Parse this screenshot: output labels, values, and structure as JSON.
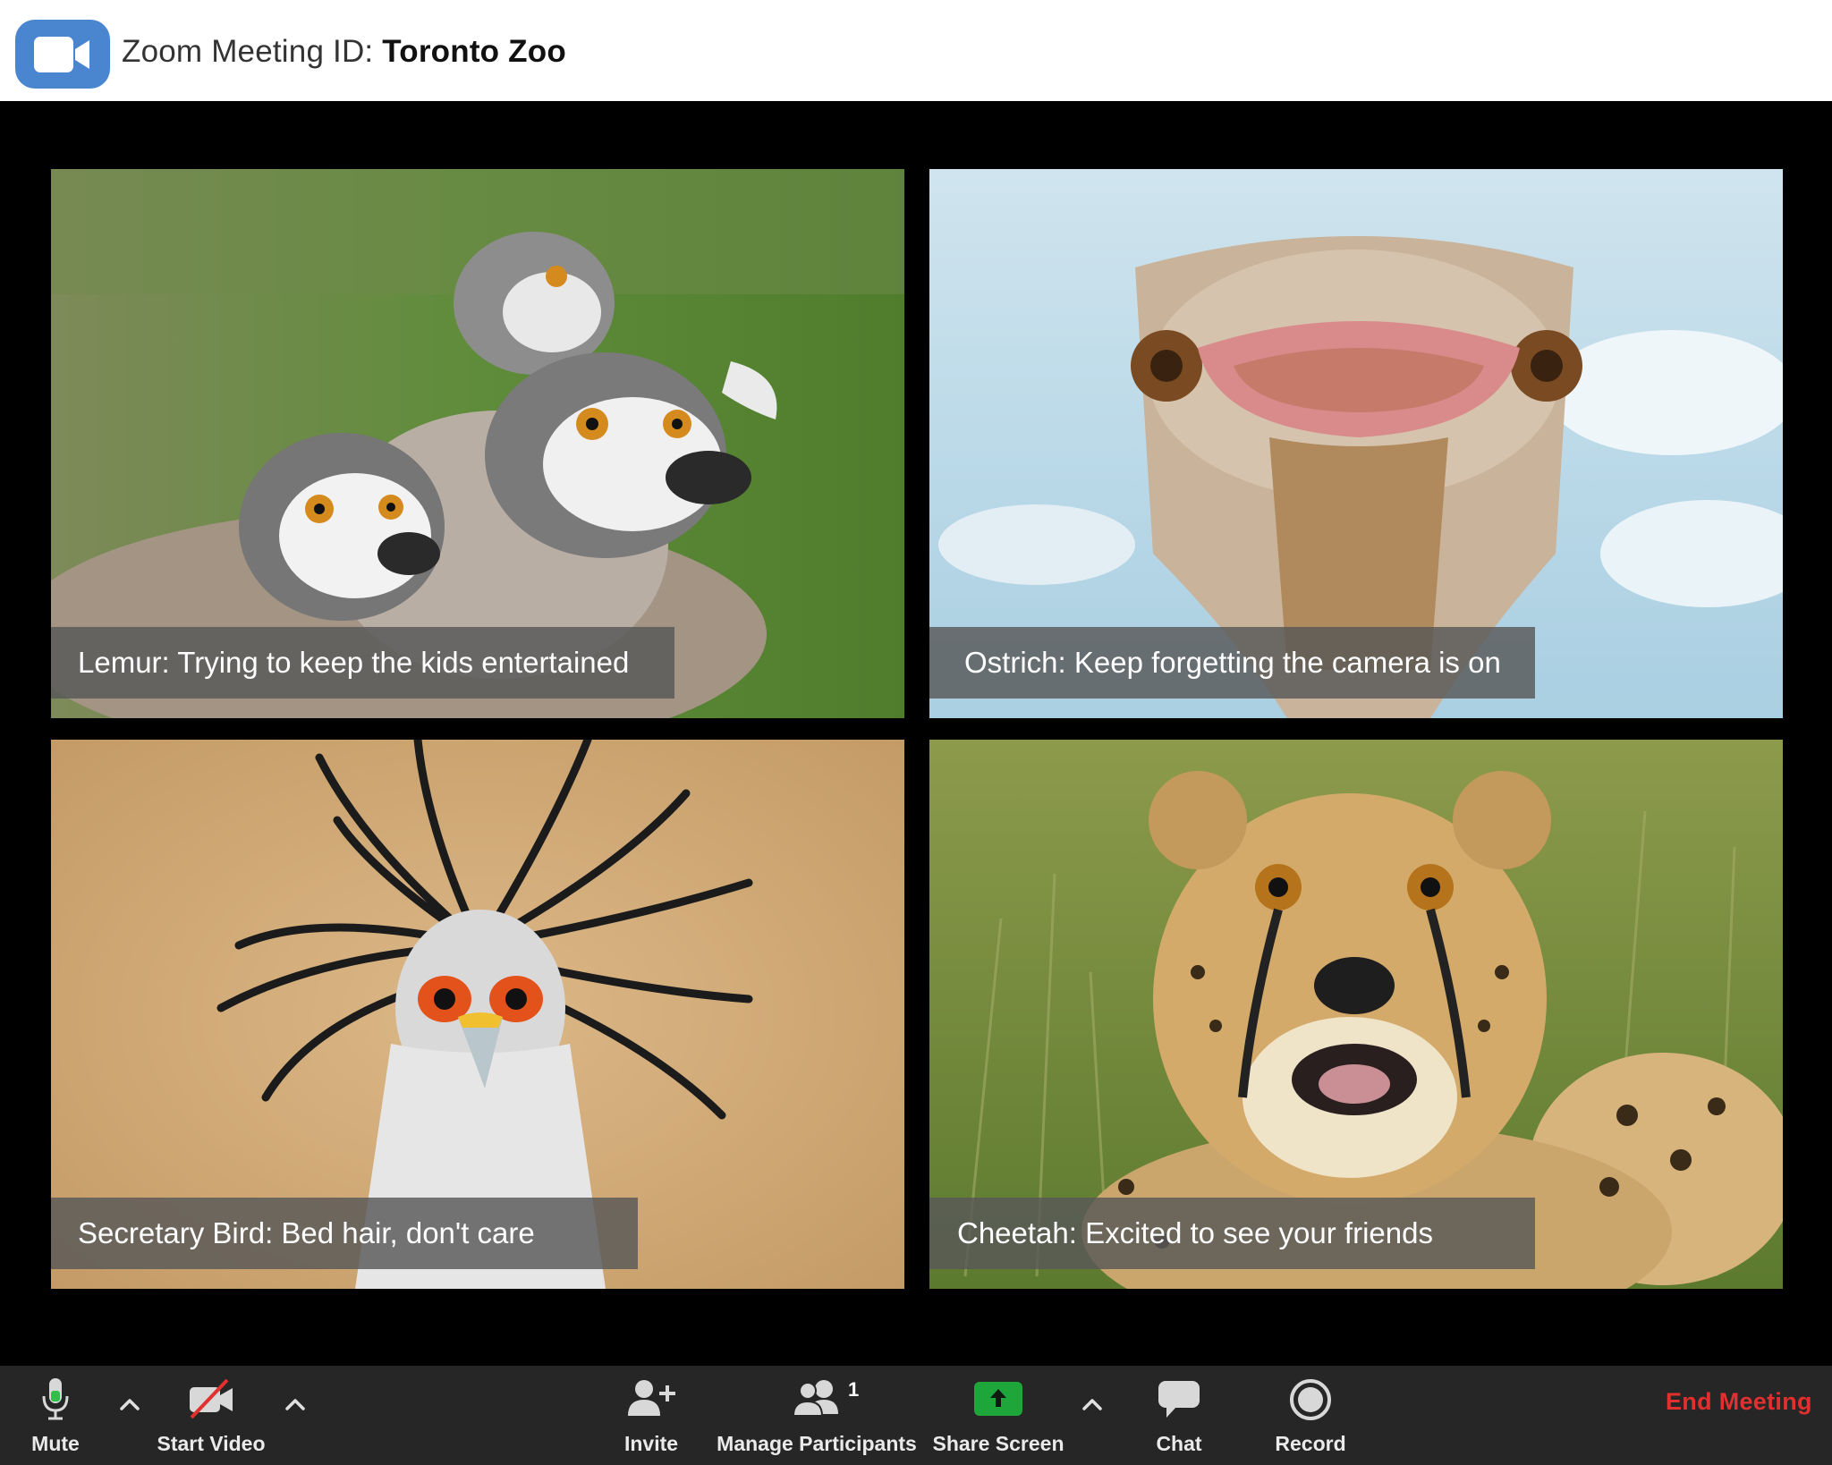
{
  "titlebar": {
    "logo_icon": "video-camera-icon",
    "title_prefix": "Zoom Meeting ID: ",
    "meeting_name": "Toronto Zoo"
  },
  "participants": [
    {
      "caption": "Lemur: Trying to keep the kids entertained",
      "photo": "lemur-photo"
    },
    {
      "caption": "Ostrich: Keep forgetting the camera is on",
      "photo": "ostrich-photo"
    },
    {
      "caption": "Secretary Bird: Bed hair, don't care",
      "photo": "secretary-bird-photo"
    },
    {
      "caption": "Cheetah: Excited to see your friends",
      "photo": "cheetah-photo"
    }
  ],
  "toolbar": {
    "mute_label": "Mute",
    "start_video_label": "Start Video",
    "invite_label": "Invite",
    "manage_participants_label": "Manage Participants",
    "participant_count": "1",
    "share_screen_label": "Share Screen",
    "chat_label": "Chat",
    "record_label": "Record",
    "end_meeting_label": "End Meeting"
  },
  "colors": {
    "brand_blue": "#4a86d0",
    "toolbar_bg": "#262626",
    "share_green": "#1fa63a",
    "end_red": "#e0312f"
  }
}
